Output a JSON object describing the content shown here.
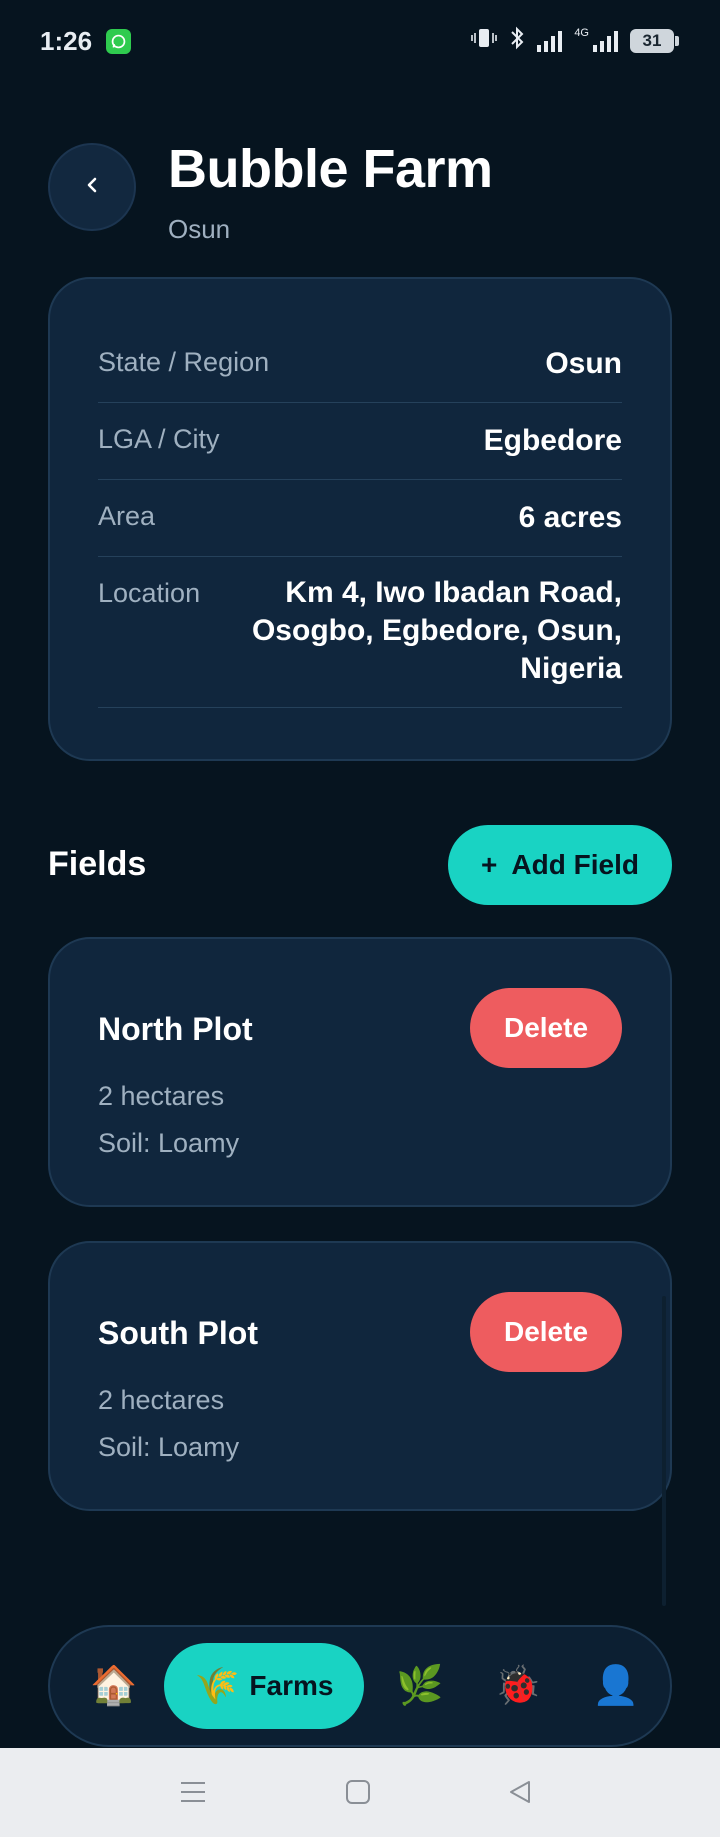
{
  "status_bar": {
    "time": "1:26",
    "network_tag": "4G",
    "battery": "31"
  },
  "header": {
    "title": "Bubble Farm",
    "subtitle": "Osun"
  },
  "farm_info": {
    "state_label": "State / Region",
    "state_value": "Osun",
    "lga_label": "LGA / City",
    "lga_value": "Egbedore",
    "area_label": "Area",
    "area_value": "6 acres",
    "location_label": "Location",
    "location_value": "Km 4, Iwo Ibadan Road, Osogbo, Egbedore, Osun, Nigeria"
  },
  "fields_section": {
    "title": "Fields",
    "add_label": "Add Field",
    "add_icon": "+"
  },
  "fields": [
    {
      "name": "North Plot",
      "size": "2 hectares",
      "soil": "Soil: Loamy",
      "delete_label": "Delete"
    },
    {
      "name": "South Plot",
      "size": "2 hectares",
      "soil": "Soil: Loamy",
      "delete_label": "Delete"
    }
  ],
  "bottom_nav": {
    "home_icon": "🏠",
    "farms_icon": "🌾",
    "farms_label": "Farms",
    "crops_icon": "🌿",
    "pests_icon": "🐞",
    "profile_icon": "👤"
  },
  "colors": {
    "background": "#06141f",
    "card": "#10263d",
    "accent": "#19d3c3",
    "danger": "#ee5c5f",
    "muted_text": "#9fb0c0"
  }
}
